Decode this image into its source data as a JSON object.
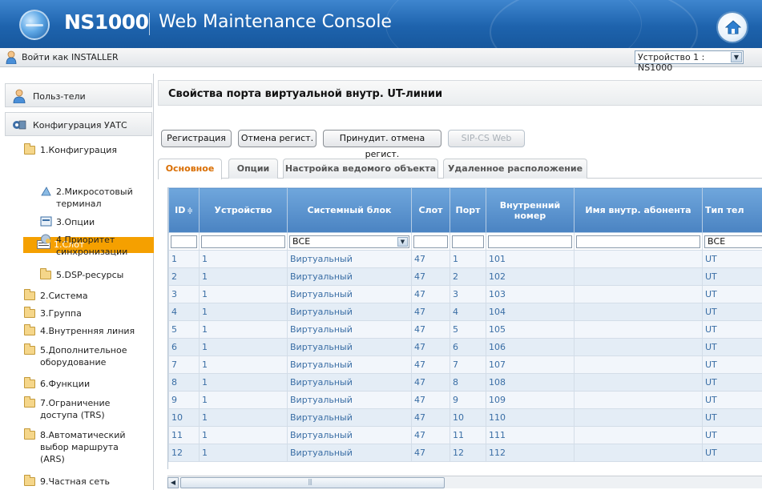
{
  "header": {
    "brand": "NS1000",
    "subtitle": "Web Maintenance Console",
    "login_text": "Войти как INSTALLER",
    "device_select": "Устройство 1 : NS1000"
  },
  "sidebar": {
    "top_items": [
      {
        "label": "Польз-тели"
      },
      {
        "label": "Конфигурация УАТС"
      }
    ],
    "tree": [
      {
        "label": "1.Конфигурация"
      },
      {
        "label": "1.Слот"
      },
      {
        "label": "2.Микросотовый терминал"
      },
      {
        "label": "3.Опции"
      },
      {
        "label": "4.Приоритет синхронизации"
      },
      {
        "label": "5.DSP-ресурсы"
      },
      {
        "label": "2.Система"
      },
      {
        "label": "3.Группа"
      },
      {
        "label": "4.Внутренняя линия"
      },
      {
        "label": "5.Дополнительное оборудование"
      },
      {
        "label": "6.Функции"
      },
      {
        "label": "7.Ограничение доступа (TRS)"
      },
      {
        "label": "8.Автоматический выбор маршрута (ARS)"
      },
      {
        "label": "9.Частная сеть"
      }
    ]
  },
  "main": {
    "title": "Свойства порта виртуальной внутр. UT-линии",
    "buttons": [
      {
        "label": "Регистрация"
      },
      {
        "label": "Отмена регист."
      },
      {
        "label": "Принудит. отмена регист."
      },
      {
        "label": "SIP-CS Web"
      }
    ],
    "tabs": [
      {
        "label": "Основное"
      },
      {
        "label": "Опции"
      },
      {
        "label": "Настройка ведомого объекта"
      },
      {
        "label": "Удаленное расположение"
      }
    ],
    "columns": [
      "ID",
      "Устройство",
      "Системный блок",
      "Слот",
      "Порт",
      "Внутренний номер",
      "Имя внутр. абонента",
      "Тип тел"
    ],
    "filter_unit_value": "ВСЕ",
    "filter_type_value": "ВСЕ",
    "rows": [
      {
        "id": "1",
        "device": "1",
        "unit": "Виртуальный",
        "slot": "47",
        "port": "1",
        "ext": "101",
        "name": "",
        "type": "UT"
      },
      {
        "id": "2",
        "device": "1",
        "unit": "Виртуальный",
        "slot": "47",
        "port": "2",
        "ext": "102",
        "name": "",
        "type": "UT"
      },
      {
        "id": "3",
        "device": "1",
        "unit": "Виртуальный",
        "slot": "47",
        "port": "3",
        "ext": "103",
        "name": "",
        "type": "UT"
      },
      {
        "id": "4",
        "device": "1",
        "unit": "Виртуальный",
        "slot": "47",
        "port": "4",
        "ext": "104",
        "name": "",
        "type": "UT"
      },
      {
        "id": "5",
        "device": "1",
        "unit": "Виртуальный",
        "slot": "47",
        "port": "5",
        "ext": "105",
        "name": "",
        "type": "UT"
      },
      {
        "id": "6",
        "device": "1",
        "unit": "Виртуальный",
        "slot": "47",
        "port": "6",
        "ext": "106",
        "name": "",
        "type": "UT"
      },
      {
        "id": "7",
        "device": "1",
        "unit": "Виртуальный",
        "slot": "47",
        "port": "7",
        "ext": "107",
        "name": "",
        "type": "UT"
      },
      {
        "id": "8",
        "device": "1",
        "unit": "Виртуальный",
        "slot": "47",
        "port": "8",
        "ext": "108",
        "name": "",
        "type": "UT"
      },
      {
        "id": "9",
        "device": "1",
        "unit": "Виртуальный",
        "slot": "47",
        "port": "9",
        "ext": "109",
        "name": "",
        "type": "UT"
      },
      {
        "id": "10",
        "device": "1",
        "unit": "Виртуальный",
        "slot": "47",
        "port": "10",
        "ext": "110",
        "name": "",
        "type": "UT"
      },
      {
        "id": "11",
        "device": "1",
        "unit": "Виртуальный",
        "slot": "47",
        "port": "11",
        "ext": "111",
        "name": "",
        "type": "UT"
      },
      {
        "id": "12",
        "device": "1",
        "unit": "Виртуальный",
        "slot": "47",
        "port": "12",
        "ext": "112",
        "name": "",
        "type": "UT"
      }
    ]
  }
}
